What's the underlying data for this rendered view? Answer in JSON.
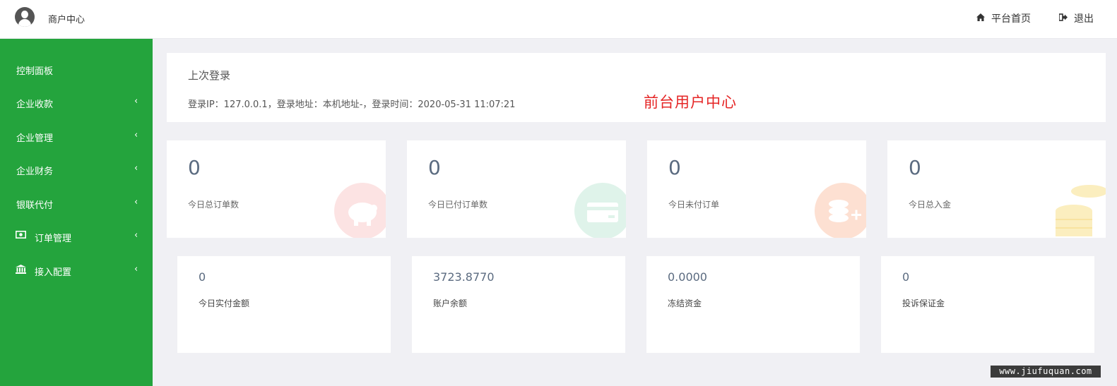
{
  "header": {
    "brand": "商户中心",
    "home_label": "平台首页",
    "logout_label": "退出"
  },
  "sidebar": {
    "items": [
      {
        "label": "控制面板",
        "has_arrow": false,
        "icon": ""
      },
      {
        "label": "企业收款",
        "has_arrow": true,
        "icon": ""
      },
      {
        "label": "企业管理",
        "has_arrow": true,
        "icon": ""
      },
      {
        "label": "企业财务",
        "has_arrow": true,
        "icon": ""
      },
      {
        "label": "银联代付",
        "has_arrow": true,
        "icon": ""
      },
      {
        "label": "订单管理",
        "has_arrow": true,
        "icon": "money-icon"
      },
      {
        "label": "接入配置",
        "has_arrow": true,
        "icon": "bank-icon"
      }
    ]
  },
  "login": {
    "title": "上次登录",
    "info": "登录IP：127.0.0.1，登录地址：本机地址-，登录时间：2020-05-31 11:07:21",
    "promo": "前台用户中心"
  },
  "stats": [
    {
      "value": "0",
      "label": "今日总订单数",
      "icon": "piggy-bank-icon",
      "color": "#f2a1a1"
    },
    {
      "value": "0",
      "label": "今日已付订单数",
      "icon": "credit-card-icon",
      "color": "#a6dfc3"
    },
    {
      "value": "0",
      "label": "今日未付订单",
      "icon": "coins-add-icon",
      "color": "#f5a37e"
    },
    {
      "value": "0",
      "label": "今日总入金",
      "icon": "coin-stack-icon",
      "color": "#f2d77a"
    }
  ],
  "balances": [
    {
      "value": "0",
      "label": "今日实付金额"
    },
    {
      "value": "3723.8770",
      "label": "账户余额"
    },
    {
      "value": "0.0000",
      "label": "冻结资金"
    },
    {
      "value": "0",
      "label": "投诉保证金"
    }
  ],
  "watermark": "www.jiufuquan.com",
  "colors": {
    "sidebar": "#24a43d",
    "promo": "#e52525"
  }
}
